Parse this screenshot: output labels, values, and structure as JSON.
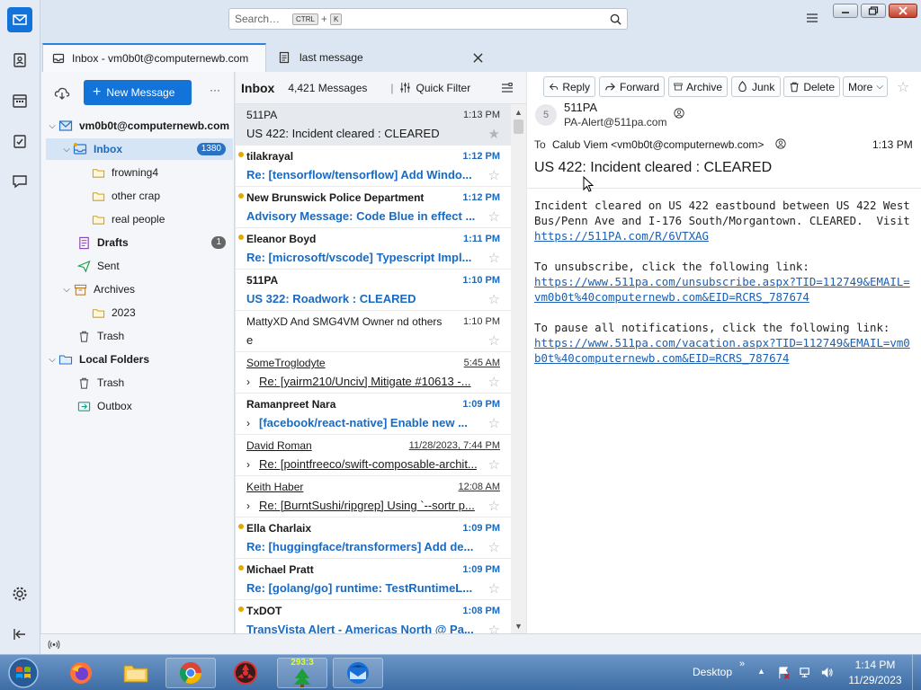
{
  "search": {
    "placeholder": "Search…",
    "kbd1": "CTRL",
    "plus": "+",
    "kbd2": "K"
  },
  "tabs": [
    {
      "label": "Inbox - vm0b0t@computernewb.com"
    },
    {
      "label": "last message"
    }
  ],
  "folder_pane": {
    "new_message_label": "New Message",
    "more_label": "···",
    "account": "vm0b0t@computernewb.com",
    "folders": [
      {
        "label": "Inbox",
        "count": "1380"
      },
      {
        "label": "frowning4"
      },
      {
        "label": "other crap"
      },
      {
        "label": "real people"
      },
      {
        "label": "Drafts",
        "count": "1"
      },
      {
        "label": "Sent"
      },
      {
        "label": "Archives"
      },
      {
        "label": "2023"
      },
      {
        "label": "Trash"
      },
      {
        "label": "Local Folders"
      },
      {
        "label": "Trash"
      },
      {
        "label": "Outbox"
      }
    ]
  },
  "thread_pane": {
    "title": "Inbox",
    "count": "4,421 Messages",
    "quick_filter": "Quick Filter",
    "rows": [
      {
        "sender": "511PA",
        "time": "1:13 PM",
        "subject": "US 422: Incident cleared : CLEARED"
      },
      {
        "sender": "tilakrayal",
        "time": "1:12 PM",
        "subject": "Re: [tensorflow/tensorflow] Add Windo..."
      },
      {
        "sender": "New Brunswick Police Department",
        "time": "1:12 PM",
        "subject": "Advisory Message: Code Blue in effect ..."
      },
      {
        "sender": "Eleanor Boyd",
        "time": "1:11 PM",
        "subject": "Re: [microsoft/vscode] Typescript Impl..."
      },
      {
        "sender": "511PA",
        "time": "1:10 PM",
        "subject": "US 322: Roadwork : CLEARED"
      },
      {
        "sender": "MattyXD And SMG4VM Owner nd others",
        "time": "1:10 PM",
        "subject": "e"
      },
      {
        "sender": "SomeTroglodyte",
        "time": "5:45 AM",
        "subject": "Re: [yairm210/Unciv] Mitigate #10613 -..."
      },
      {
        "sender": "Ramanpreet Nara",
        "time": "1:09 PM",
        "subject": "[facebook/react-native] Enable new ..."
      },
      {
        "sender": "David Roman",
        "time": "11/28/2023, 7:44 PM",
        "subject": "Re: [pointfreeco/swift-composable-archit..."
      },
      {
        "sender": "Keith Haber",
        "time": "12:08 AM",
        "subject": "Re: [BurntSushi/ripgrep] Using `--sortr p..."
      },
      {
        "sender": "Ella Charlaix",
        "time": "1:09 PM",
        "subject": "Re: [huggingface/transformers] Add de..."
      },
      {
        "sender": "Michael Pratt",
        "time": "1:09 PM",
        "subject": "Re: [golang/go] runtime: TestRuntimeL..."
      },
      {
        "sender": "TxDOT",
        "time": "1:08 PM",
        "subject": "TransVista Alert - Americas North @ Pa..."
      }
    ]
  },
  "message": {
    "toolbar": {
      "reply": "Reply",
      "forward": "Forward",
      "archive": "Archive",
      "junk": "Junk",
      "delete": "Delete",
      "more": "More"
    },
    "avatar_letter": "5",
    "from_name": "511PA",
    "from_email": "PA-Alert@511pa.com",
    "to_label": "To",
    "to_value": "Calub Viem <vm0b0t@computernewb.com>",
    "time": "1:13 PM",
    "subject": "US 422: Incident cleared : CLEARED",
    "body1": "Incident cleared on US 422 eastbound between US 422 West Bus/Penn Ave and I-176 South/Morgantown. CLEARED.  Visit ",
    "link1": "https://511PA.com/R/6VTXAG",
    "body2": "To unsubscribe, click the following link:",
    "link2": "https://www.511pa.com/unsubscribe.aspx?TID=112749&EMAIL=vm0b0t%40computernewb.com&EID=RCRS_787674",
    "body3": "To pause all notifications, click the following link:",
    "link3": "https://www.511pa.com/vacation.aspx?TID=112749&EMAIL=vm0b0t%40computernewb.com&EID=RCRS_787674"
  },
  "taskbar": {
    "desktop_label": "Desktop",
    "clock_time": "1:14 PM",
    "clock_date": "11/29/2023",
    "tray_counter": "293:3"
  },
  "colors": {
    "accent": "#1373d9",
    "unread_blue": "#1a6ac0",
    "badge": "#2a73c4",
    "taskbar": "#3e6ea6"
  }
}
